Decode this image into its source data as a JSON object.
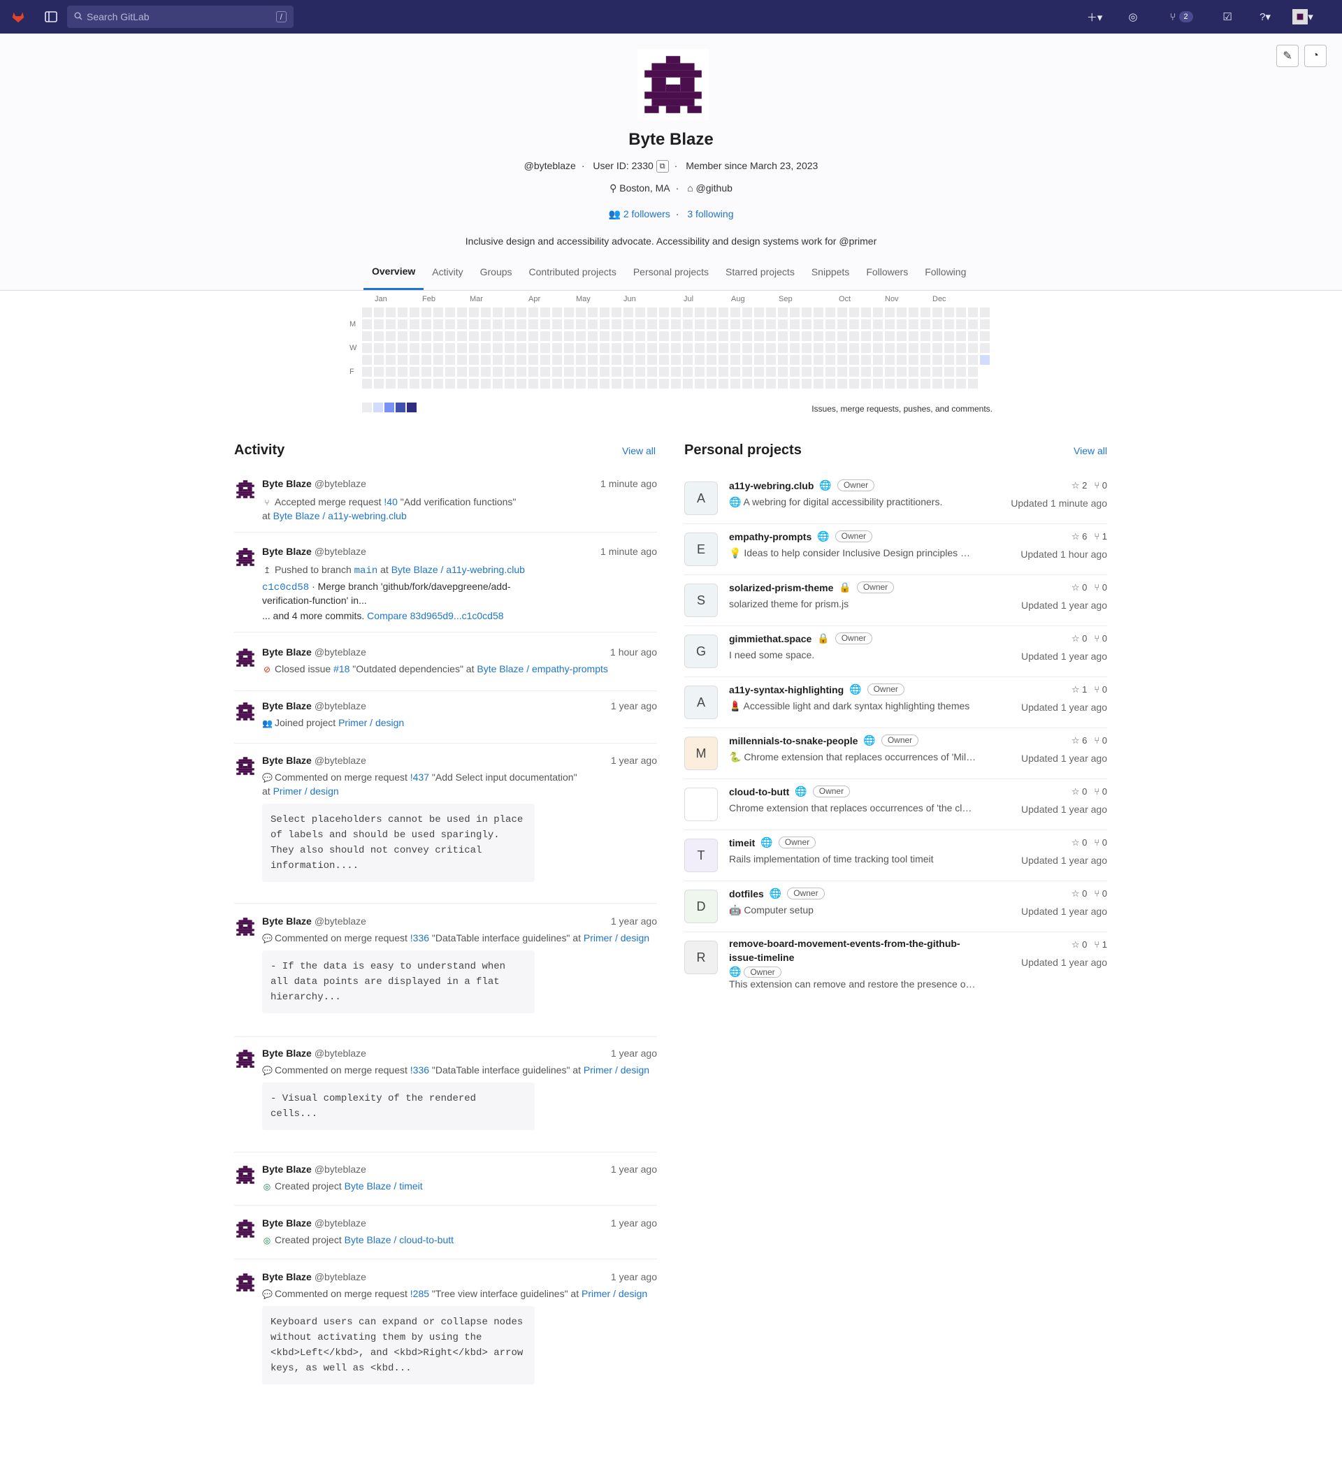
{
  "topbar": {
    "search_placeholder": "Search GitLab",
    "search_shortcut": "/",
    "mr_count": "2"
  },
  "profile": {
    "name": "Byte Blaze",
    "handle": "@byteblaze",
    "user_id": "User ID: 2330",
    "member_since": "Member since March 23, 2023",
    "location": "Boston, MA",
    "org": "@github",
    "followers": "2 followers",
    "following": "3 following",
    "bio": "Inclusive design and accessibility advocate. Accessibility and design systems work for @primer"
  },
  "tabs": [
    "Overview",
    "Activity",
    "Groups",
    "Contributed projects",
    "Personal projects",
    "Starred projects",
    "Snippets",
    "Followers",
    "Following"
  ],
  "calendar": {
    "months": [
      "Jan",
      "Feb",
      "Mar",
      "Apr",
      "May",
      "Jun",
      "Jul",
      "Aug",
      "Sep",
      "Oct",
      "Nov",
      "Dec"
    ],
    "days": [
      "M",
      "W",
      "F"
    ],
    "note": "Issues, merge requests, pushes, and comments.",
    "colors": [
      "#ececef",
      "#d2dcff",
      "#7992f5",
      "#3f51ae",
      "#2e2e80"
    ]
  },
  "activity": {
    "title": "Activity",
    "view_all": "View all",
    "events": [
      {
        "author": "Byte Blaze",
        "handle": "@byteblaze",
        "time": "1 minute ago",
        "l1a": "Accepted merge request",
        "l1b": "!40",
        "l1c": "\"Add verification functions\"",
        "l2a": "at",
        "l2b": "Byte Blaze / a11y-webring.club"
      },
      {
        "author": "Byte Blaze",
        "handle": "@byteblaze",
        "time": "1 minute ago",
        "l1a": "Pushed to branch",
        "l1b": "main",
        "l1c": "at",
        "l1d": "Byte Blaze / a11y-webring.club",
        "l2b": "c1c0cd58",
        "l2c": "· Merge branch 'github/fork/davepgreene/add-",
        "l3": "verification-function' in...",
        "l4a": "... and 4 more commits.",
        "l4b": "Compare 83d965d9...c1c0cd58"
      },
      {
        "author": "Byte Blaze",
        "handle": "@byteblaze",
        "time": "1 hour ago",
        "l1a": "Closed issue",
        "l1b": "#18",
        "l1c": "\"Outdated dependencies\" at",
        "l1d": "Byte Blaze / empathy-prompts"
      },
      {
        "author": "Byte Blaze",
        "handle": "@byteblaze",
        "time": "1 year ago",
        "l1a": "Joined project",
        "l1b": "Primer / design"
      },
      {
        "author": "Byte Blaze",
        "handle": "@byteblaze",
        "time": "1 year ago",
        "l1a": "Commented on merge request",
        "l1b": "!437",
        "l1c": "\"Add Select input documentation\"",
        "l2a": "at",
        "l2b": "Primer / design",
        "note": "Select placeholders cannot be used in place of labels and should be used sparingly. They also should not convey critical information...."
      },
      {
        "author": "Byte Blaze",
        "handle": "@byteblaze",
        "time": "1 year ago",
        "l1a": "Commented on merge request",
        "l1b": "!336",
        "l1c": "\"DataTable interface guidelines\" at",
        "l1d": "Primer / design",
        "note": "- If the data is easy to understand when all data points are displayed in a flat hierarchy..."
      },
      {
        "author": "Byte Blaze",
        "handle": "@byteblaze",
        "time": "1 year ago",
        "l1a": "Commented on merge request",
        "l1b": "!336",
        "l1c": "\"DataTable interface guidelines\" at",
        "l1d": "Primer / design",
        "note": "- Visual complexity of the rendered cells..."
      },
      {
        "author": "Byte Blaze",
        "handle": "@byteblaze",
        "time": "1 year ago",
        "l1a": "Created project",
        "l1b": "Byte Blaze / timeit"
      },
      {
        "author": "Byte Blaze",
        "handle": "@byteblaze",
        "time": "1 year ago",
        "l1a": "Created project",
        "l1b": "Byte Blaze / cloud-to-butt"
      },
      {
        "author": "Byte Blaze",
        "handle": "@byteblaze",
        "time": "1 year ago",
        "l1a": "Commented on merge request",
        "l1b": "!285",
        "l1c": "\"Tree view interface guidelines\" at",
        "l1d": "Primer / design",
        "note": "Keyboard users can expand or collapse nodes without activating them by using the <kbd>Left</kbd>, and <kbd>Right</kbd> arrow keys, as well as <kbd..."
      }
    ]
  },
  "projects": {
    "title": "Personal projects",
    "view_all": "View all",
    "owner_label": "Owner",
    "items": [
      {
        "letter": "A",
        "name": "a11y-webring.club",
        "vis": "public",
        "desc": "🌐 A webring for digital accessibility practitioners.",
        "stars": "2",
        "forks": "0",
        "updated": "Updated 1 minute ago"
      },
      {
        "letter": "E",
        "name": "empathy-prompts",
        "vis": "public",
        "desc": "💡 Ideas to help consider Inclusive Design principles when making things for others to use.",
        "stars": "6",
        "forks": "1",
        "updated": "Updated 1 hour ago"
      },
      {
        "letter": "S",
        "name": "solarized-prism-theme",
        "vis": "private",
        "desc": "solarized theme for prism.js",
        "stars": "0",
        "forks": "0",
        "updated": "Updated 1 year ago"
      },
      {
        "letter": "G",
        "name": "gimmiethat.space",
        "vis": "private",
        "desc": "I need some space.",
        "stars": "0",
        "forks": "0",
        "updated": "Updated 1 year ago"
      },
      {
        "letter": "A",
        "name": "a11y-syntax-highlighting",
        "vis": "public",
        "desc": "💄 Accessible light and dark syntax highlighting themes",
        "stars": "1",
        "forks": "0",
        "updated": "Updated 1 year ago"
      },
      {
        "letter": "M",
        "name": "millennials-to-snake-people",
        "vis": "public",
        "desc": "🐍 Chrome extension that replaces occurrences of 'Millennials' with 'Snake People'",
        "stars": "6",
        "forks": "0",
        "updated": "Updated 1 year ago"
      },
      {
        "letter": "",
        "name": "cloud-to-butt",
        "vis": "public",
        "desc": "Chrome extension that replaces occurrences of 'the cloud' with 'my butt'",
        "stars": "0",
        "forks": "0",
        "updated": "Updated 1 year ago"
      },
      {
        "letter": "T",
        "name": "timeit",
        "vis": "public",
        "desc": "Rails implementation of time tracking tool timeit",
        "stars": "0",
        "forks": "0",
        "updated": "Updated 1 year ago"
      },
      {
        "letter": "D",
        "name": "dotfiles",
        "vis": "public",
        "desc": "🤖 Computer setup",
        "stars": "0",
        "forks": "0",
        "updated": "Updated 1 year ago"
      },
      {
        "letter": "R",
        "name": "remove-board-movement-events-from-the-github-issue-timeline",
        "vis": "public",
        "desc": "This extension can remove and restore the presence of board movement events from GitHub issues.",
        "stars": "0",
        "forks": "1",
        "updated": "Updated 1 year ago"
      }
    ]
  }
}
